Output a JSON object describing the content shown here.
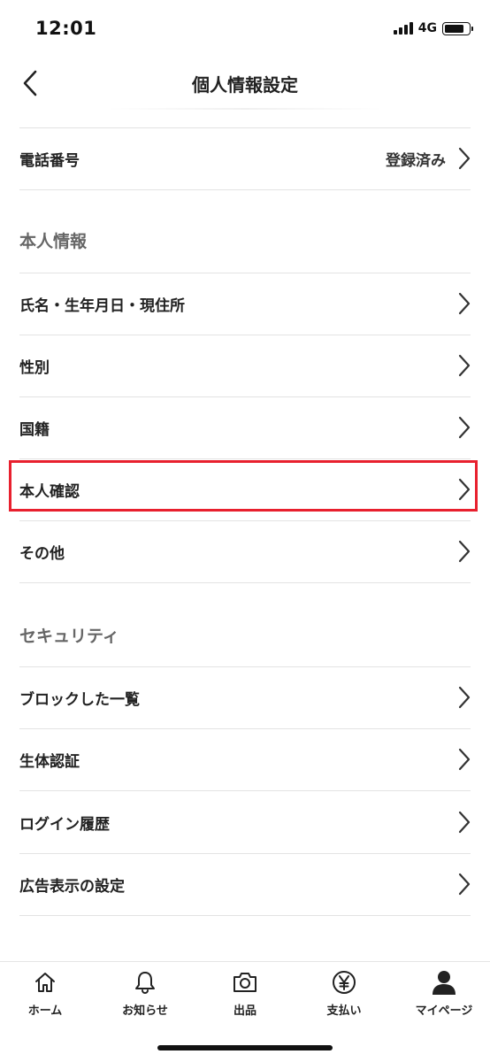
{
  "status_bar": {
    "time": "12:01",
    "network": "4G"
  },
  "header": {
    "title": "個人情報設定"
  },
  "rows": {
    "phone": {
      "label": "電話番号",
      "value": "登録済み"
    },
    "name": {
      "label": "氏名・生年月日・現住所"
    },
    "gender": {
      "label": "性別"
    },
    "nationality": {
      "label": "国籍"
    },
    "identity": {
      "label": "本人確認"
    },
    "other": {
      "label": "その他"
    },
    "block": {
      "label": "ブロックした一覧"
    },
    "biometric": {
      "label": "生体認証"
    },
    "login_history": {
      "label": "ログイン履歴"
    },
    "ads": {
      "label": "広告表示の設定"
    }
  },
  "sections": {
    "personal": "本人情報",
    "security": "セキュリティ"
  },
  "tabs": [
    {
      "label": "ホーム",
      "icon": "home-icon"
    },
    {
      "label": "お知らせ",
      "icon": "bell-icon"
    },
    {
      "label": "出品",
      "icon": "camera-icon"
    },
    {
      "label": "支払い",
      "icon": "yen-icon"
    },
    {
      "label": "マイページ",
      "icon": "person-icon"
    }
  ],
  "colors": {
    "highlight": "#e8202e",
    "section_text": "#666666",
    "divider": "#e3e3e3"
  }
}
